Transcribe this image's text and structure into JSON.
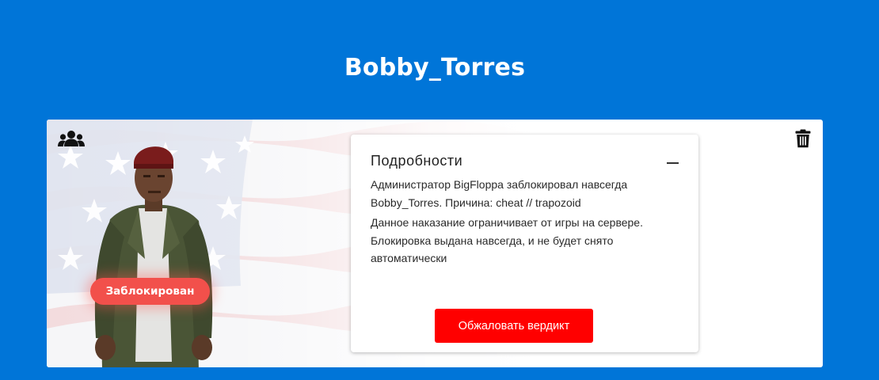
{
  "page": {
    "title": "Bobby_Torres"
  },
  "card": {
    "status_badge": "Заблокирован",
    "icons": {
      "group": "users-group-icon",
      "delete": "trash-icon",
      "collapse": "minus-icon"
    }
  },
  "details": {
    "title": "Подробности",
    "paragraph1": "Администратор BigFloppa заблокировал навсегда Bobby_Torres. Причина: cheat // trapozoid",
    "paragraph2": "Данное наказание ограничивает от игры на сервере. Блокировка выдана навсегда, и не будет снято автоматически",
    "appeal_button": "Обжаловать вердикт"
  },
  "colors": {
    "background": "#0075d8",
    "badge": "#f2504b",
    "button": "#ff0000"
  }
}
